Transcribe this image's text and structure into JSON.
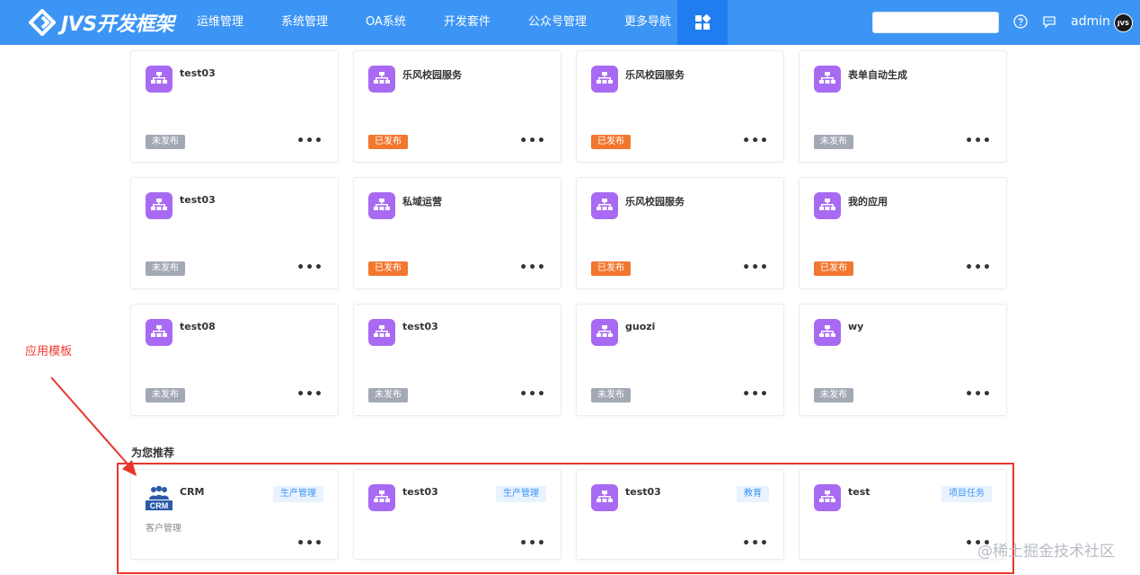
{
  "header": {
    "logo_text": "JVS开发框架",
    "nav": [
      "运维管理",
      "系统管理",
      "OA系统",
      "开发套件",
      "公众号管理"
    ],
    "more_nav": "更多导航",
    "search_value": "",
    "user_name": "admin",
    "avatar_text": "JVS",
    "accent": "#3c95f5"
  },
  "apps": [
    {
      "name": "test03",
      "status": "未发布",
      "published": false
    },
    {
      "name": "乐风校园服务",
      "status": "已发布",
      "published": true
    },
    {
      "name": "乐风校园服务",
      "status": "已发布",
      "published": true
    },
    {
      "name": "表单自动生成",
      "status": "未发布",
      "published": false
    },
    {
      "name": "test03",
      "status": "未发布",
      "published": false
    },
    {
      "name": "私域运营",
      "status": "已发布",
      "published": true
    },
    {
      "name": "乐风校园服务",
      "status": "已发布",
      "published": true
    },
    {
      "name": "我的应用",
      "status": "已发布",
      "published": true
    },
    {
      "name": "test08",
      "status": "未发布",
      "published": false
    },
    {
      "name": "test03",
      "status": "未发布",
      "published": false
    },
    {
      "name": "guozi",
      "status": "未发布",
      "published": false
    },
    {
      "name": "wy",
      "status": "未发布",
      "published": false
    }
  ],
  "recommend": {
    "title": "为您推荐",
    "items": [
      {
        "name": "CRM",
        "tag": "生产管理",
        "desc": "客户管理",
        "icon": "crm-logo"
      },
      {
        "name": "test03",
        "tag": "生产管理",
        "desc": "",
        "icon": "app-icon"
      },
      {
        "name": "test03",
        "tag": "教育",
        "desc": "",
        "icon": "app-icon"
      },
      {
        "name": "test",
        "tag": "项目任务",
        "desc": "",
        "icon": "app-icon"
      }
    ]
  },
  "more_label": "•••",
  "annotation": {
    "label": "应用模板",
    "color": "#ee3a2d"
  },
  "watermark": "@稀土掘金技术社区"
}
